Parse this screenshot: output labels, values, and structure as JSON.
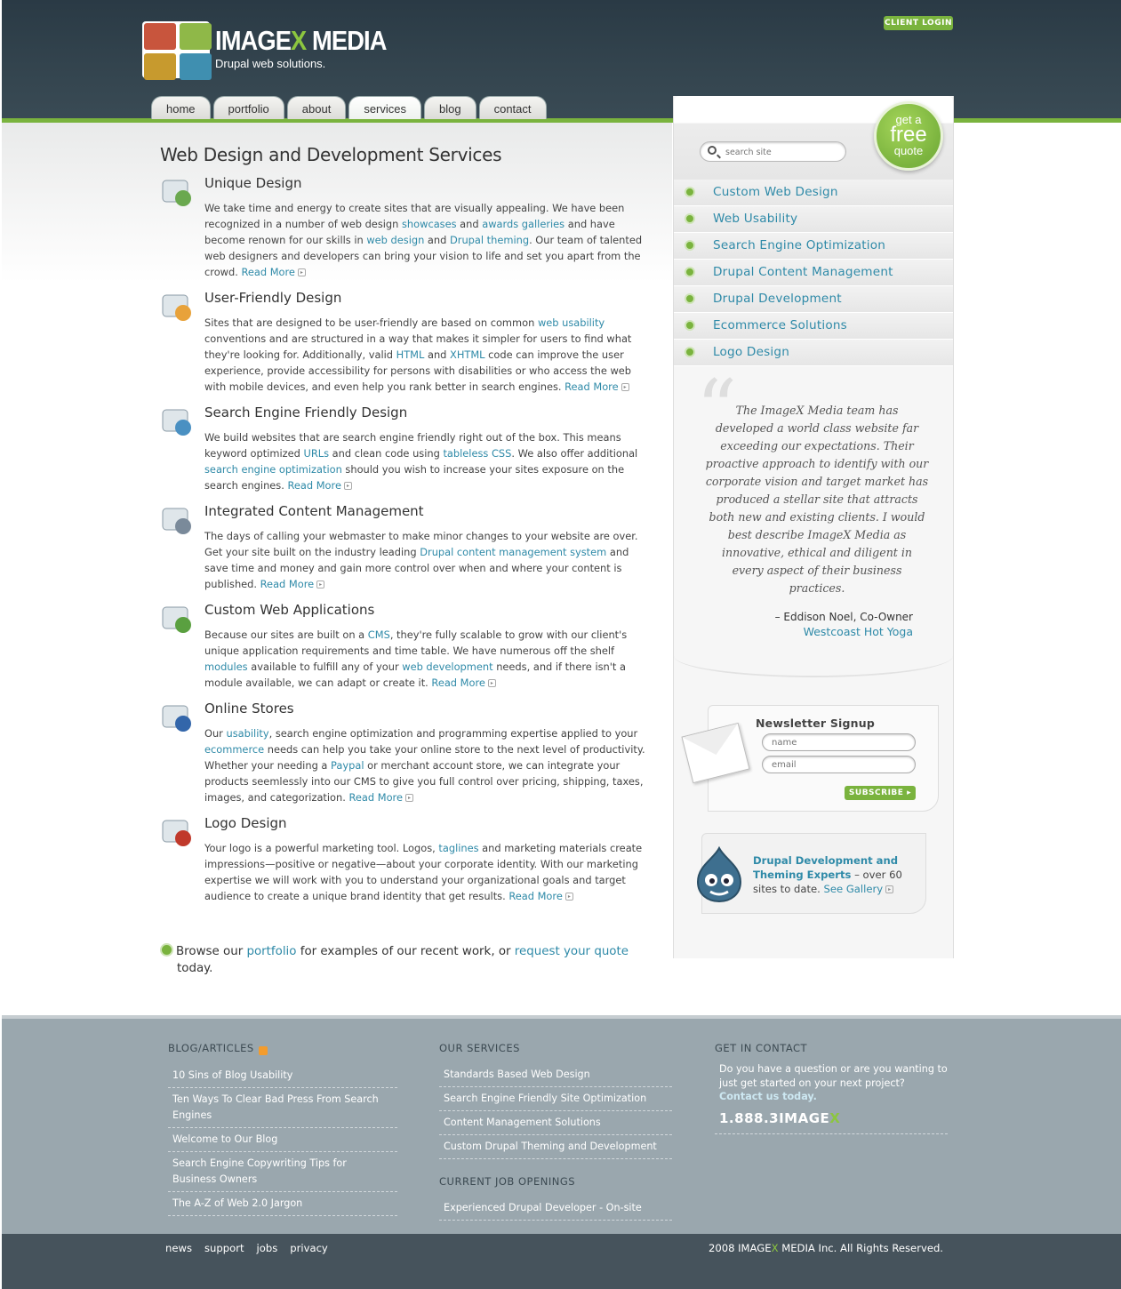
{
  "header": {
    "logo_word_left": "IMAGE",
    "logo_word_x": "X",
    "logo_word_right": " MEDIA",
    "logo_tagline": "Drupal web solutions.",
    "client_login": "CLIENT LOGIN"
  },
  "nav": {
    "tabs": [
      {
        "label": "home"
      },
      {
        "label": "portfolio"
      },
      {
        "label": "about"
      },
      {
        "label": "services",
        "active": true
      },
      {
        "label": "blog"
      },
      {
        "label": "contact"
      }
    ]
  },
  "main": {
    "title": "Web Design and Development Services",
    "read_more": "Read More",
    "sections": [
      {
        "title": "Unique Design",
        "icon": "star-icon",
        "parts": [
          "We take time and energy to create sites that are visually appealing. We have been recognized in a number of web design ",
          "showcases",
          " and ",
          "awards galleries",
          " and have become renown for our skills in ",
          "web design",
          " and ",
          "Drupal theming",
          ". Our team of talented web designers and developers can bring your vision to life and set you apart from the crowd. "
        ]
      },
      {
        "title": "User-Friendly Design",
        "icon": "smiley-windows-icon",
        "parts": [
          "Sites that are designed to be user-friendly are based on common ",
          "web usability",
          " conventions and are structured in a way that makes it simpler for users to find what they're looking for. Additionally, valid ",
          "HTML",
          " and ",
          "XHTML",
          " code can improve the user experience, provide accessibility for persons with disabilities or who access the web with mobile devices, and even help you rank better in search engines. "
        ]
      },
      {
        "title": "Search Engine Friendly Design",
        "icon": "magnifier-icon",
        "parts": [
          "We build websites that are search engine friendly right out of the box. This means keyword optimized ",
          "URLs",
          " and clean code using ",
          "tableless CSS",
          ". We also offer additional ",
          "search engine optimization",
          " should you wish to increase your sites exposure on the search engines. "
        ]
      },
      {
        "title": "Integrated Content Management",
        "icon": "gear-screen-icon",
        "parts": [
          "The days of calling your webmaster to make minor changes to your website are over. Get your site built on the industry leading ",
          "Drupal content management system",
          " and save time and money and gain more control over when and where your content is published. "
        ]
      },
      {
        "title": "Custom Web Applications",
        "icon": "applications-icon",
        "parts": [
          "Because our sites are built on a ",
          "CMS",
          ", they're fully scalable to grow with our client's unique application requirements and time table. We have numerous off the shelf ",
          "modules",
          " available to fulfill any of your ",
          "web development",
          " needs, and if there isn't a module available, we can adapt or create it. "
        ]
      },
      {
        "title": "Online Stores",
        "icon": "store-cursor-icon",
        "parts": [
          "Our ",
          "usability",
          ", search engine optimization and programming expertise applied to your ",
          "ecommerce",
          " needs can help you take your online store to the next level of productivity. Whether your needing a ",
          "Paypal",
          " or merchant account store, we can integrate your products seemlessly into our CMS to give you full control over pricing, shipping, taxes, images, and categorization. "
        ]
      },
      {
        "title": "Logo Design",
        "icon": "logo-circles-icon",
        "parts": [
          "Your logo is a powerful marketing tool. Logos, ",
          "taglines",
          " and marketing materials create impressions—positive or negative—about your corporate identity. With our marketing expertise we will work with you to understand your organizational goals and target audience to create a unique brand identity that get results. "
        ]
      }
    ],
    "browse": {
      "t1": "Browse our ",
      "link1": "portfolio",
      "t2": " for examples of our recent work, or ",
      "link2": "request your quote",
      "t3": " today."
    }
  },
  "sidebar": {
    "search_placeholder": "search site",
    "quote": {
      "line1": "get a",
      "line2": "free",
      "line3": "quote"
    },
    "menu": [
      "Custom Web Design",
      "Web Usability",
      "Search Engine Optimization",
      "Drupal Content Management",
      "Drupal Development",
      "Ecommerce Solutions",
      "Logo Design"
    ],
    "testimonial": {
      "quote": "The ImageX Media team has developed a world class website far exceeding our expectations. Their proactive approach to identify with our corporate vision and target market has produced a stellar site that attracts both new and existing clients. I would best describe ImageX Media as innovative, ethical and diligent in every aspect of their business practices.",
      "author": "– Eddison Noel, Co-Owner",
      "company": "Westcoast Hot Yoga"
    },
    "newsletter": {
      "title": "Newsletter Signup",
      "name_placeholder": "name",
      "email_placeholder": "email",
      "subscribe": "SUBSCRIBE"
    },
    "drupal": {
      "bold": "Drupal Development and Theming Experts",
      "rest": " – over 60 sites to date. ",
      "link": "See Gallery"
    }
  },
  "footer": {
    "blog": {
      "heading": "BLOG/ARTICLES",
      "items": [
        "10 Sins of Blog Usability",
        "Ten Ways To Clear Bad Press From Search Engines",
        "Welcome to Our Blog",
        "Search Engine Copywriting Tips for Business Owners",
        "The A-Z of Web 2.0 Jargon"
      ]
    },
    "services": {
      "heading": "OUR SERVICES",
      "items": [
        "Standards Based Web Design",
        "Search Engine Friendly Site Optimization",
        "Content Management Solutions",
        "Custom Drupal Theming and Development"
      ]
    },
    "jobs": {
      "heading": "CURRENT JOB OPENINGS",
      "items": [
        "Experienced Drupal Developer - On-site"
      ]
    },
    "contact": {
      "heading": "GET IN CONTACT",
      "text": "Do you have a question or are you wanting to just get started on your next project?",
      "link": "Contact us today.",
      "phone_left": "1.888.3IMAGE",
      "phone_x": "X"
    },
    "bottom_links": [
      "news",
      "support",
      "jobs",
      "privacy"
    ],
    "copyright_left": "2008 IMAGE",
    "copyright_x": "X",
    "copyright_right": " MEDIA Inc. All Rights Reserved."
  },
  "colors": {
    "accent_green": "#7ab33e",
    "link_blue": "#2f8aa8",
    "header_dark": "#34454f",
    "footer_gray": "#9aa7ae"
  }
}
